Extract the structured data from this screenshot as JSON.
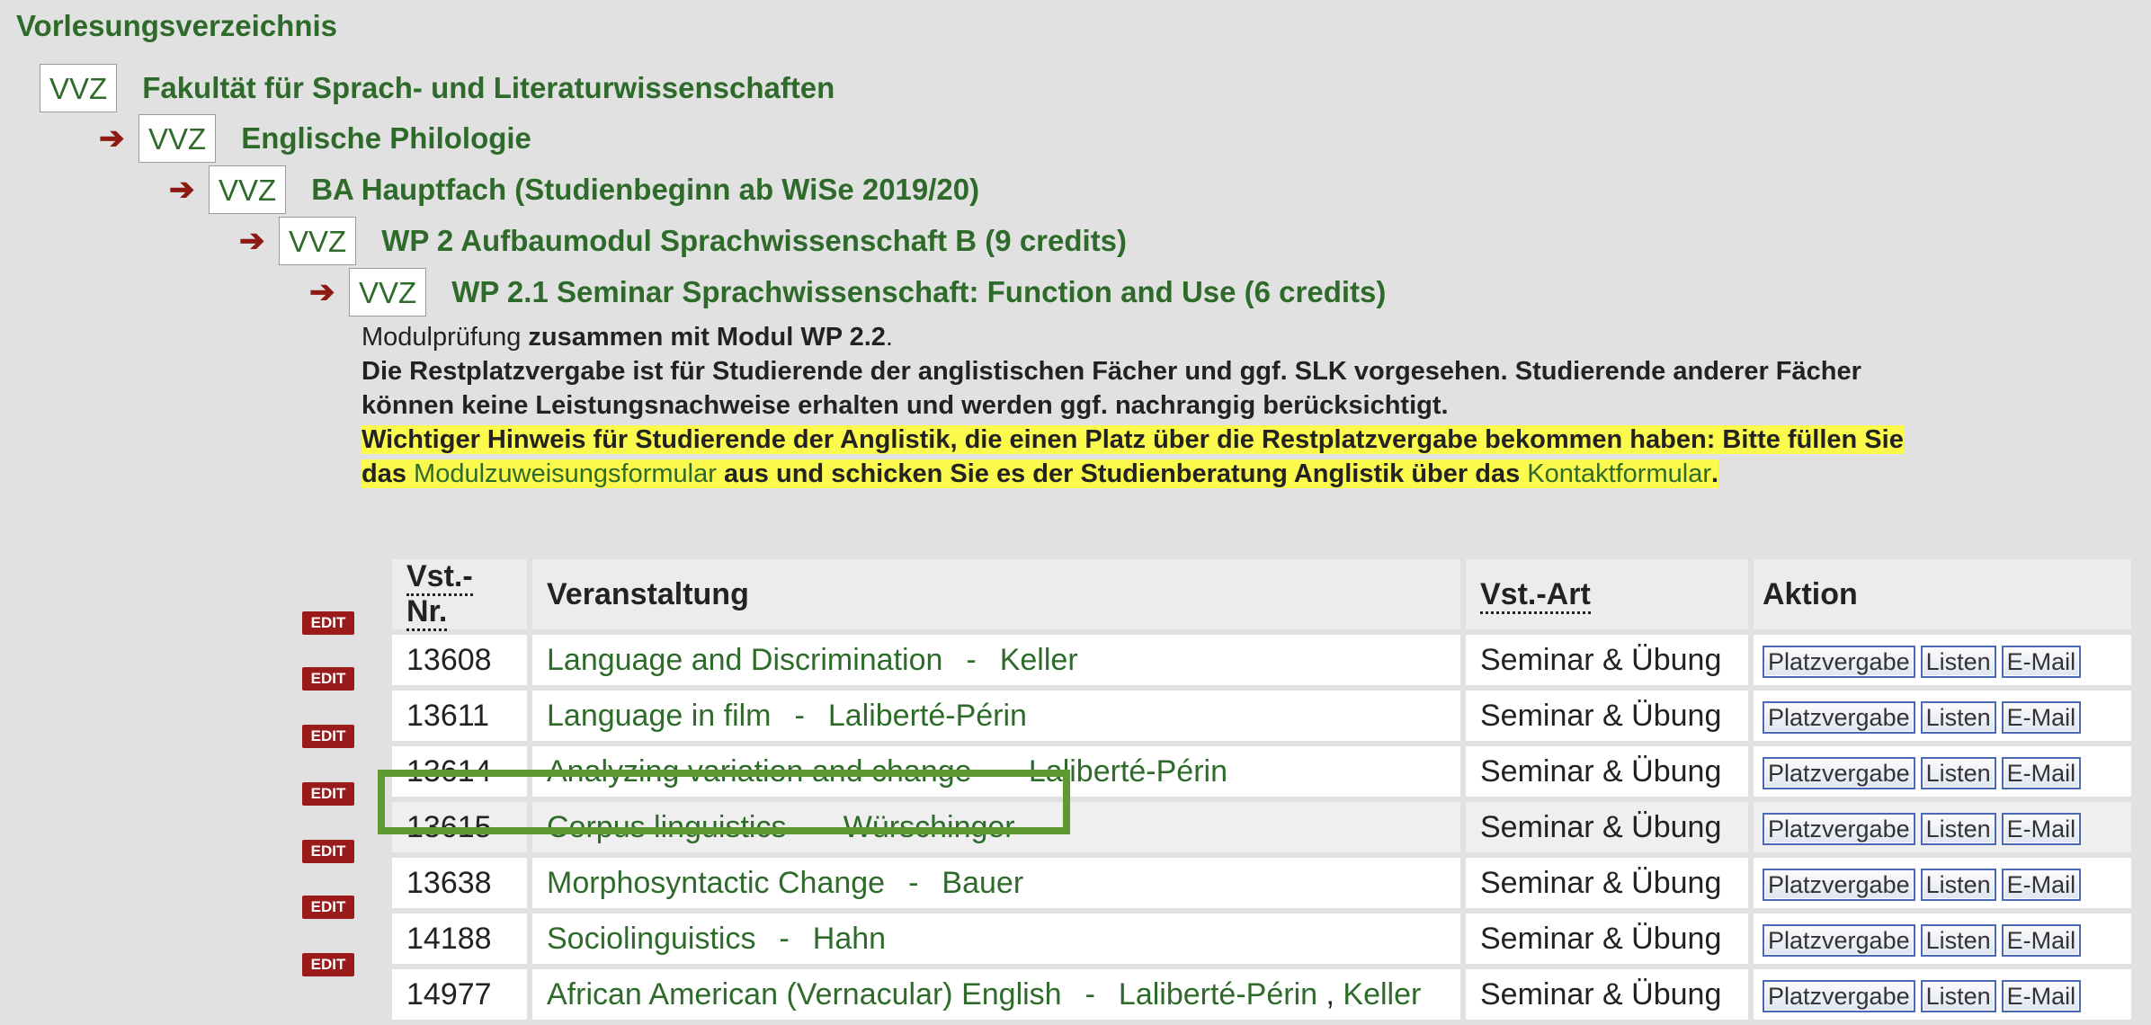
{
  "page_title": "Vorlesungsverzeichnis",
  "breadcrumbs": [
    {
      "badge": "VVZ",
      "label": "Fakultät für Sprach- und Literaturwissenschaften"
    },
    {
      "badge": "VVZ",
      "label": "Englische Philologie"
    },
    {
      "badge": "VVZ",
      "label": "BA Hauptfach (Studienbeginn ab WiSe 2019/20)"
    },
    {
      "badge": "VVZ",
      "label": "WP 2 Aufbaumodul Sprachwissenschaft B (9 credits)"
    },
    {
      "badge": "VVZ",
      "label": "WP 2.1 Seminar Sprachwissenschaft: Function and Use (6 credits)"
    }
  ],
  "info": {
    "line1_prefix": "Modulprüfung ",
    "line1_bold": "zusammen mit Modul WP 2.2",
    "line1_suffix": ".",
    "line2": "Die Restplatzvergabe ist für Studierende der anglistischen Fächer und ggf. SLK vorgesehen. Studierende anderer Fächer",
    "line3": "können keine Leistungsnachweise erhalten und werden ggf. nachrangig berücksichtigt.",
    "notice_line1": "Wichtiger Hinweis für Studierende der Anglistik, die einen Platz über die Restplatzvergabe bekommen haben: Bitte füllen Sie",
    "notice_line2_a": "das ",
    "notice_link1": "Modulzuweisungsformular",
    "notice_line2_b": " aus und schicken Sie es der Studienberatung Anglistik über das ",
    "notice_link2": "Kontaktformular",
    "notice_line2_c": "."
  },
  "table": {
    "headers": {
      "nr": "Vst.-Nr.",
      "title": "Veranstaltung",
      "art": "Vst.-Art",
      "action": "Aktion"
    },
    "edit_label": "EDIT",
    "separator": "-",
    "buttons": {
      "platz": "Platzvergabe",
      "listen": "Listen",
      "email": "E-Mail"
    },
    "rows": [
      {
        "nr": "13608",
        "title": "Language and Discrimination",
        "lecturer": "Keller",
        "lecturer2": "",
        "art": "Seminar & Übung"
      },
      {
        "nr": "13611",
        "title": "Language in film",
        "lecturer": "Laliberté-Périn",
        "lecturer2": "",
        "art": "Seminar & Übung"
      },
      {
        "nr": "13614",
        "title": "Analyzing variation and change",
        "lecturer": "Laliberté-Périn",
        "lecturer2": "",
        "art": "Seminar & Übung"
      },
      {
        "nr": "13615",
        "title": "Corpus linguistics",
        "lecturer": "Würschinger",
        "lecturer2": "",
        "art": "Seminar & Übung"
      },
      {
        "nr": "13638",
        "title": "Morphosyntactic Change",
        "lecturer": "Bauer",
        "lecturer2": "",
        "art": "Seminar & Übung"
      },
      {
        "nr": "14188",
        "title": "Sociolinguistics",
        "lecturer": "Hahn",
        "lecturer2": "",
        "art": "Seminar & Übung"
      },
      {
        "nr": "14977",
        "title": "African American (Vernacular) English",
        "lecturer": "Laliberté-Périn",
        "lecturer2": "Keller",
        "art": "Seminar & Übung"
      }
    ]
  },
  "colors": {
    "link_green": "#2e6b2b",
    "arrow_red": "#8e1a14",
    "highlight_yellow": "#fdfa4e",
    "box_green": "#5d9a32"
  }
}
